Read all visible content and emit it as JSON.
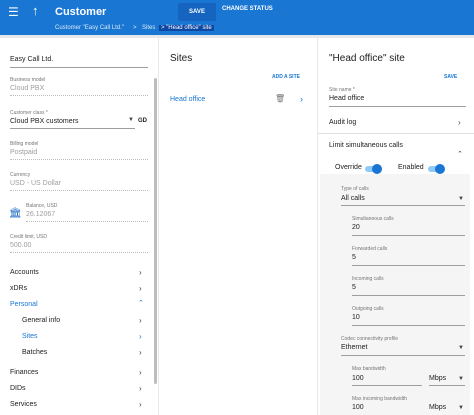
{
  "topbar": {
    "title": "Customer",
    "save_label": "SAVE",
    "change_status_label": "CHANGE STATUS"
  },
  "breadcrumb": [
    "Customer \"Easy Call Ltd.\"",
    "Sites",
    "\"Head office\" site"
  ],
  "left": {
    "name": "Easy Call Ltd.",
    "business_model_label": "Business model",
    "business_model": "Cloud PBX",
    "customer_class_label": "Customer class *",
    "customer_class": "Cloud PBX customers",
    "customer_class_badge": "GD",
    "billing_model_label": "Billing model",
    "billing_model": "Postpaid",
    "currency_label": "Currency",
    "currency": "USD - US Dollar",
    "balance_label": "Balance, USD",
    "balance": "26.12067",
    "credit_limit_label": "Credit limit, USD",
    "credit_limit": "500.00",
    "nav": [
      "Accounts",
      "xDRs",
      "Personal",
      "General info",
      "Sites",
      "Batches",
      "Finances",
      "DIDs",
      "Services"
    ]
  },
  "sites": {
    "title": "Sites",
    "add_label": "ADD A SITE",
    "items": [
      "Head office"
    ]
  },
  "detail": {
    "title": "\"Head office\" site",
    "save_label": "SAVE",
    "site_name_label": "Site name *",
    "site_name": "Head office",
    "audit_log": "Audit log",
    "limit_calls": "Limit simultaneous calls",
    "override_label": "Override",
    "enabled_label": "Enabled",
    "type_of_calls_label": "Type of calls",
    "type_of_calls": "All calls",
    "simultaneous_label": "Simultaneous calls",
    "simultaneous": "20",
    "forwarded_label": "Forwarded calls",
    "forwarded": "5",
    "incoming_label": "Incoming calls",
    "incoming": "5",
    "outgoing_label": "Outgoing calls",
    "outgoing": "10",
    "codec_label": "Codec connectivity profile",
    "codec": "Ethernet",
    "max_bw_label": "Max bandwidth",
    "max_bw": "100",
    "max_bw_unit": "Mbps",
    "max_in_bw_label": "Max incoming bandwidth",
    "max_in_bw": "100",
    "max_in_bw_unit": "Mbps"
  }
}
